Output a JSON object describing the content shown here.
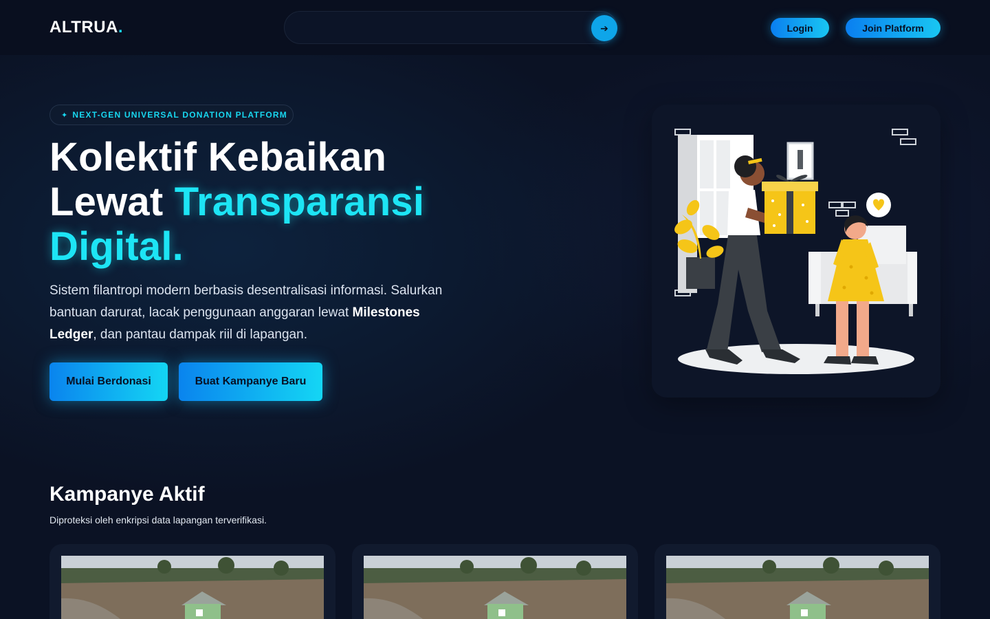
{
  "brand": {
    "name": "ALTRUA",
    "dot": "."
  },
  "search": {
    "placeholder": "",
    "button_icon": "arrow-right-icon",
    "button_glyph": "➔"
  },
  "nav": {
    "login_label": "Login",
    "join_label": "Join Platform"
  },
  "hero": {
    "badge_icon": "sparkle-icon",
    "badge_glyph": "✦",
    "badge_text": "NEXT-GEN UNIVERSAL DONATION PLATFORM",
    "title_line1": "Kolektif Kebaikan",
    "title_line2_plain": "Lewat ",
    "title_line2_accent": "Transparansi",
    "title_line3_accent": "Digital.",
    "description_part1": "Sistem filantropi modern berbasis desentralisasi informasi. Salurkan bantuan darurat, lacak penggunaan anggaran lewat ",
    "description_bold": "Milestones Ledger",
    "description_part2": ", dan pantau dampak riil di lapangan.",
    "cta_primary": "Mulai Berdonasi",
    "cta_secondary": "Buat Kampanye Baru"
  },
  "campaigns": {
    "title": "Kampanye Aktif",
    "subtitle": "Diproteksi oleh enkripsi data lapangan terverifikasi.",
    "cards": [
      {
        "image_icon": "flood-photo"
      },
      {
        "image_icon": "flood-photo"
      },
      {
        "image_icon": "flood-photo"
      }
    ]
  },
  "colors": {
    "accent": "#1de5f5",
    "button_gradient_start": "#0a84ee",
    "button_gradient_end": "#14d6f4",
    "background": "#0b1224"
  }
}
